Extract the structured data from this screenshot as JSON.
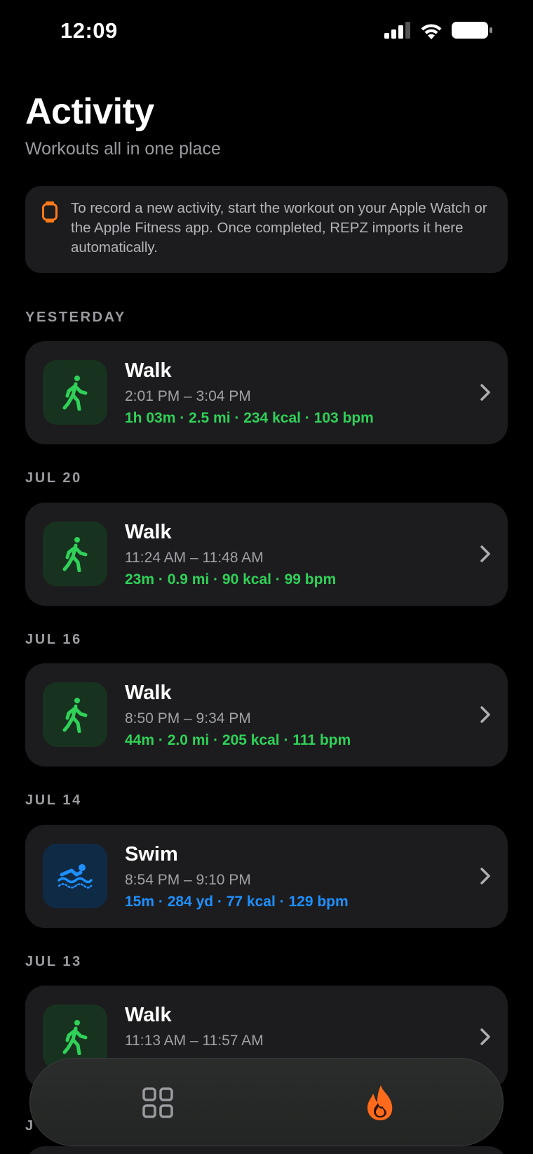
{
  "status_bar": {
    "time": "12:09",
    "signal_icon": "cellular-signal-icon",
    "wifi_icon": "wifi-icon",
    "battery_icon": "battery-icon"
  },
  "header": {
    "title": "Activity",
    "subtitle": "Workouts all in one place"
  },
  "info": {
    "icon": "apple-watch-icon",
    "text": "To record a new activity, start the workout on your Apple Watch or the Apple Fitness app. Once completed, REPZ imports it here automatically."
  },
  "sections": [
    {
      "label": "YESTERDAY",
      "workout": {
        "type": "Walk",
        "icon": "walking-figure-icon",
        "time": "2:01 PM – 3:04 PM",
        "stats": "1h 03m · 2.5 mi · 234 kcal · 103 bpm"
      }
    },
    {
      "label": "JUL 20",
      "workout": {
        "type": "Walk",
        "icon": "walking-figure-icon",
        "time": "11:24 AM – 11:48 AM",
        "stats": "23m · 0.9 mi · 90 kcal · 99 bpm"
      }
    },
    {
      "label": "JUL 16",
      "workout": {
        "type": "Walk",
        "icon": "walking-figure-icon",
        "time": "8:50 PM – 9:34 PM",
        "stats": "44m · 2.0 mi · 205 kcal · 111 bpm"
      }
    },
    {
      "label": "JUL 14",
      "workout": {
        "type": "Swim",
        "icon": "swimmer-icon",
        "time": "8:54 PM – 9:10 PM",
        "stats": "15m · 284 yd · 77 kcal · 129 bpm"
      }
    },
    {
      "label": "JUL 13",
      "workout": {
        "type": "Walk",
        "icon": "walking-figure-icon",
        "time": "11:13 AM – 11:57 AM",
        "stats": ""
      }
    }
  ],
  "clipped_label": "J",
  "tab_bar": {
    "items": [
      {
        "icon": "grid-dashboard-icon",
        "selected": false
      },
      {
        "icon": "flame-icon",
        "selected": true
      }
    ]
  },
  "colors": {
    "background": "#000000",
    "card": "#1c1c1e",
    "walk_accent": "#30d158",
    "swim_accent": "#1e90ff",
    "watch_accent": "#ff7a1a",
    "flame_accent": "#ff6b1a",
    "secondary_text": "#9a9a9f"
  }
}
